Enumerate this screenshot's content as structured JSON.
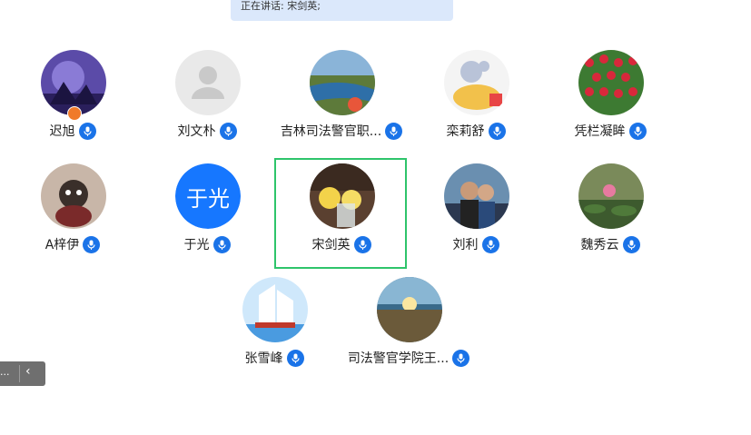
{
  "banner": {
    "speaking_text": "正在讲话: 宋剑英;"
  },
  "participants": [
    {
      "name": "迟旭",
      "icon": "mic-icon",
      "host": true
    },
    {
      "name": "刘文朴",
      "icon": "mic-icon"
    },
    {
      "name": "吉林司法警官职...",
      "icon": "mic-icon"
    },
    {
      "name": "栾莉舒",
      "icon": "mic-icon"
    },
    {
      "name": "凭栏凝眸",
      "icon": "mic-icon"
    },
    {
      "name": "A梓伊",
      "icon": "mic-icon"
    },
    {
      "name": "于光",
      "icon": "mic-icon",
      "avatar_text": "于光"
    },
    {
      "name": "宋剑英",
      "icon": "mic-icon",
      "speaking": true
    },
    {
      "name": "刘利",
      "icon": "mic-icon"
    },
    {
      "name": "魏秀云",
      "icon": "mic-icon"
    },
    {
      "name": "张雪峰",
      "icon": "mic-icon"
    },
    {
      "name": "司法警官学院王...",
      "icon": "mic-icon"
    }
  ],
  "side_control": {
    "text": "...",
    "chevron": "‹"
  },
  "colors": {
    "accent": "#1a73e8",
    "active_border": "#2ec46b",
    "banner_bg": "#dbe8fb"
  }
}
